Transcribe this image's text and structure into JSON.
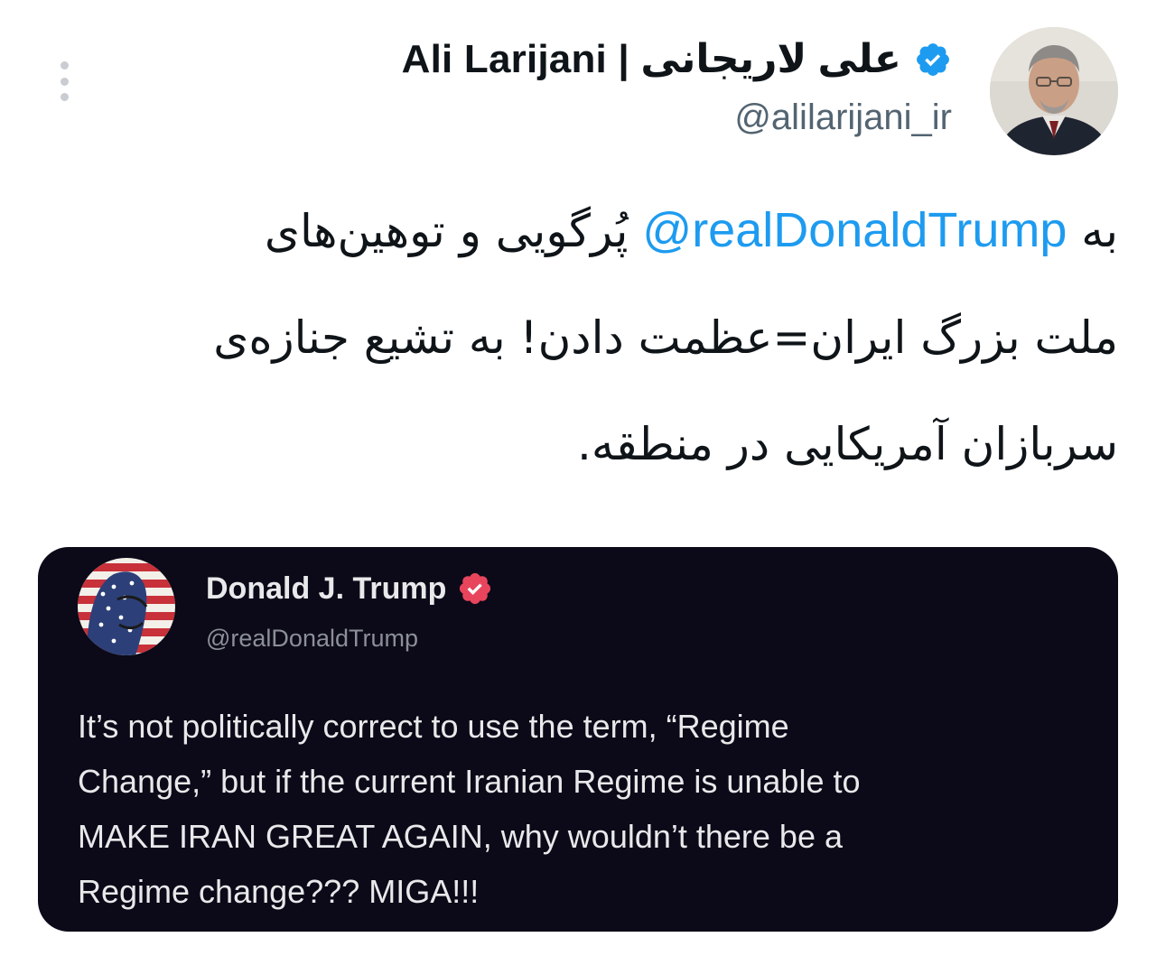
{
  "header": {
    "display_name": "Ali Larijani | علی لاریجانی",
    "handle": "@alilarijani_ir",
    "verified_icon": "verified-badge-icon",
    "more_icon": "more-options-icon"
  },
  "tweet": {
    "lines": [
      {
        "before": "به ",
        "mention": "@realDonaldTrump",
        "after": " پُرگویی و توهین‌های"
      },
      {
        "text": "ملت بزرگ ایران=عظمت دادن! به تشیع جنازه‌ی"
      },
      {
        "text": "سربازان آمریکایی در منطقه."
      }
    ]
  },
  "quote": {
    "display_name": "Donald J. Trump",
    "handle": "@realDonaldTrump",
    "verified_icon": "verified-badge-icon",
    "lines": [
      "It’s not politically correct to use the term, “Regime",
      "Change,” but if the current Iranian Regime is unable to",
      "MAKE IRAN GREAT AGAIN, why wouldn’t there be a",
      "Regime change??? MIGA!!!"
    ]
  },
  "colors": {
    "mention": "#1d9bf0",
    "verified_main": "#1d9bf0",
    "verified_quote": "#e8455d",
    "quote_background": "#0c0a18",
    "handle": "#536471"
  }
}
